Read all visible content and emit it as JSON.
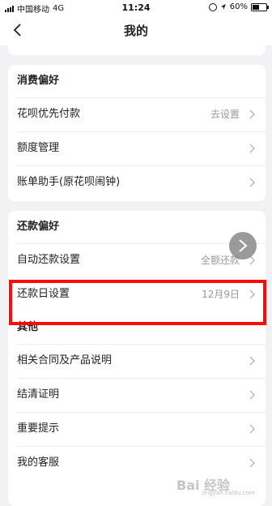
{
  "status_bar": {
    "carrier": "中国移动",
    "network": "4G",
    "time": "11:24",
    "battery": "60%",
    "battery_level": 0.6
  },
  "nav": {
    "title": "我的"
  },
  "sections": [
    {
      "title": "消费偏好",
      "rows": [
        {
          "label": "花呗优先付款",
          "value": "去设置"
        },
        {
          "label": "额度管理",
          "value": ""
        },
        {
          "label": "账单助手(原花呗闹钟)",
          "value": ""
        }
      ]
    },
    {
      "title": "还款偏好",
      "rows": [
        {
          "label": "自动还款设置",
          "value": "全额还款"
        },
        {
          "label": "还款日设置",
          "value": "12月9日"
        }
      ]
    },
    {
      "title": "其他",
      "rows": [
        {
          "label": "相关合同及产品说明",
          "value": ""
        },
        {
          "label": "结清证明",
          "value": ""
        },
        {
          "label": "重要提示",
          "value": ""
        },
        {
          "label": "我的客服",
          "value": ""
        }
      ]
    }
  ],
  "annotation_color": "#ff0a0a",
  "watermark": {
    "text": "Bai 经验",
    "sub": "jingyan.baidu.com"
  }
}
